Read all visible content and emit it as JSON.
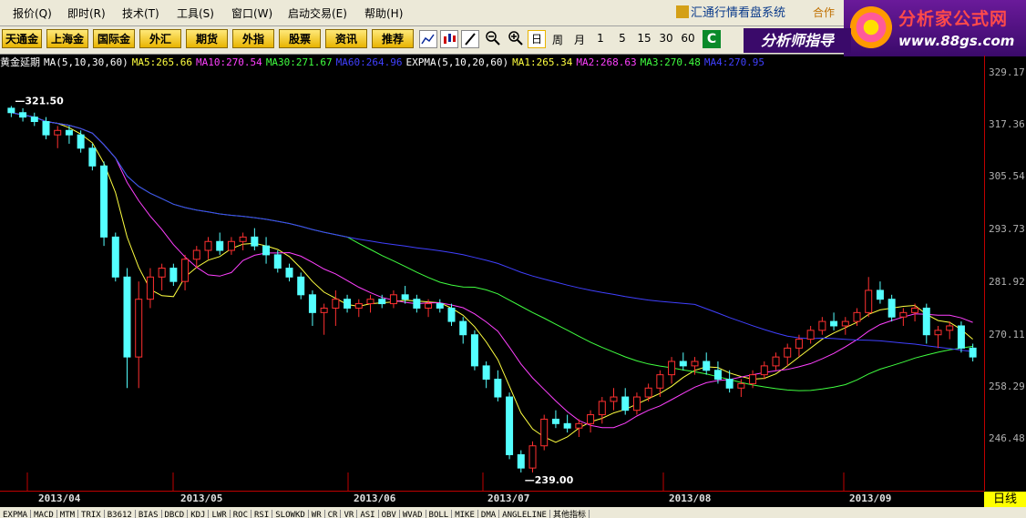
{
  "menu": {
    "items": [
      "报价(Q)",
      "即时(R)",
      "技术(T)",
      "工具(S)",
      "窗口(W)",
      "启动交易(E)",
      "帮助(H)"
    ],
    "brand": "汇通行情看盘系统",
    "brand_sub": "合作"
  },
  "logo": {
    "title": "分析家公式网",
    "url": "www.88gs.com"
  },
  "toolbar": {
    "buttons": [
      "天通金",
      "上海金",
      "国际金",
      "外汇",
      "期货",
      "外指",
      "股票",
      "资讯",
      "推荐"
    ],
    "periods": [
      "日",
      "周",
      "月",
      "1",
      "5",
      "15",
      "30",
      "60"
    ],
    "active_period": "日",
    "analyst": "分析师指导"
  },
  "indicators": {
    "symbol": "黄金延期",
    "ma_label": "MA(5,10,30,60)",
    "ma": [
      {
        "label": "MA5:265.66",
        "color": "#ffff40"
      },
      {
        "label": "MA10:270.54",
        "color": "#ff40ff"
      },
      {
        "label": "MA30:271.67",
        "color": "#40ff40"
      },
      {
        "label": "MA60:264.96",
        "color": "#4040ff"
      }
    ],
    "expma_label": "EXPMA(5,10,20,60)",
    "expma": [
      {
        "label": "MA1:265.34",
        "color": "#ffff40"
      },
      {
        "label": "MA2:268.63",
        "color": "#ff40ff"
      },
      {
        "label": "MA3:270.48",
        "color": "#40ff40"
      },
      {
        "label": "MA4:270.95",
        "color": "#4040ff"
      }
    ]
  },
  "yaxis": {
    "ticks": [
      "329.17",
      "317.36",
      "305.54",
      "293.73",
      "281.92",
      "270.11",
      "258.29",
      "246.48"
    ]
  },
  "xaxis": {
    "ticks": [
      "2013/04",
      "2013/05",
      "2013/06",
      "2013/07",
      "2013/08",
      "2013/09"
    ]
  },
  "period_label": "日线",
  "annotations": {
    "high": "321.50",
    "low": "239.00"
  },
  "bottom_tabs": [
    "EXPMA",
    "MACD",
    "MTM",
    "TRIX",
    "B3612",
    "BIAS",
    "DBCD",
    "KDJ",
    "LWR",
    "ROC",
    "RSI",
    "SLOWKD",
    "WR",
    "CR",
    "VR",
    "ASI",
    "OBV",
    "WVAD",
    "BOLL",
    "MIKE",
    "DMA",
    "ANGLELINE",
    "其他指标"
  ],
  "chart_data": {
    "type": "candlestick",
    "ylim": [
      239,
      329.17
    ],
    "candles": [
      [
        321,
        321.5,
        319,
        320
      ],
      [
        320,
        321,
        318,
        319
      ],
      [
        319,
        320,
        317,
        318
      ],
      [
        318,
        319,
        314,
        315
      ],
      [
        315,
        317,
        312,
        316
      ],
      [
        316,
        317,
        313,
        315
      ],
      [
        315,
        316,
        311,
        312
      ],
      [
        312,
        313,
        307,
        308
      ],
      [
        308,
        309,
        290,
        292
      ],
      [
        292,
        293,
        282,
        283
      ],
      [
        283,
        285,
        258,
        265
      ],
      [
        265,
        282,
        258,
        278
      ],
      [
        278,
        285,
        276,
        283
      ],
      [
        283,
        286,
        280,
        285
      ],
      [
        285,
        286,
        281,
        282
      ],
      [
        282,
        288,
        280,
        287
      ],
      [
        287,
        290,
        285,
        289
      ],
      [
        289,
        292,
        287,
        291
      ],
      [
        291,
        293,
        288,
        289
      ],
      [
        289,
        292,
        288,
        291
      ],
      [
        291,
        293,
        289,
        292
      ],
      [
        292,
        294,
        289,
        290
      ],
      [
        290,
        292,
        286,
        288
      ],
      [
        288,
        289,
        284,
        285
      ],
      [
        285,
        286,
        282,
        283
      ],
      [
        283,
        284,
        278,
        279
      ],
      [
        279,
        280,
        272,
        275
      ],
      [
        275,
        277,
        270,
        276
      ],
      [
        276,
        280,
        272,
        278
      ],
      [
        278,
        279,
        275,
        276
      ],
      [
        276,
        278,
        274,
        277
      ],
      [
        277,
        279,
        275,
        278
      ],
      [
        278,
        279,
        276,
        277
      ],
      [
        277,
        280,
        276,
        279
      ],
      [
        279,
        281,
        277,
        278
      ],
      [
        278,
        279,
        275,
        276
      ],
      [
        276,
        278,
        274,
        277
      ],
      [
        277,
        278,
        275,
        276
      ],
      [
        276,
        277,
        272,
        273
      ],
      [
        273,
        274,
        268,
        270
      ],
      [
        270,
        271,
        262,
        263
      ],
      [
        263,
        264,
        258,
        260
      ],
      [
        260,
        262,
        255,
        256
      ],
      [
        256,
        257,
        242,
        243
      ],
      [
        243,
        244,
        239,
        240
      ],
      [
        240,
        246,
        239,
        245
      ],
      [
        245,
        252,
        244,
        251
      ],
      [
        251,
        253,
        249,
        250
      ],
      [
        250,
        252,
        248,
        249
      ],
      [
        249,
        251,
        247,
        250
      ],
      [
        250,
        253,
        248,
        252
      ],
      [
        252,
        256,
        250,
        255
      ],
      [
        255,
        258,
        253,
        256
      ],
      [
        256,
        258,
        252,
        253
      ],
      [
        253,
        257,
        252,
        256
      ],
      [
        256,
        259,
        255,
        258
      ],
      [
        258,
        262,
        256,
        261
      ],
      [
        261,
        265,
        259,
        264
      ],
      [
        264,
        266,
        262,
        263
      ],
      [
        263,
        265,
        261,
        264
      ],
      [
        264,
        266,
        261,
        262
      ],
      [
        262,
        264,
        259,
        260
      ],
      [
        260,
        262,
        257,
        258
      ],
      [
        258,
        260,
        256,
        259
      ],
      [
        259,
        262,
        258,
        261
      ],
      [
        261,
        264,
        260,
        263
      ],
      [
        263,
        266,
        262,
        265
      ],
      [
        265,
        268,
        263,
        267
      ],
      [
        267,
        270,
        265,
        269
      ],
      [
        269,
        272,
        268,
        271
      ],
      [
        271,
        274,
        270,
        273
      ],
      [
        273,
        275,
        271,
        272
      ],
      [
        272,
        274,
        270,
        273
      ],
      [
        273,
        276,
        272,
        275
      ],
      [
        275,
        283,
        274,
        280
      ],
      [
        280,
        282,
        277,
        278
      ],
      [
        278,
        279,
        273,
        274
      ],
      [
        274,
        276,
        272,
        275
      ],
      [
        275,
        277,
        273,
        276
      ],
      [
        276,
        277,
        268,
        270
      ],
      [
        270,
        272,
        267,
        271
      ],
      [
        271,
        273,
        269,
        272
      ],
      [
        272,
        273,
        266,
        267
      ],
      [
        267,
        268,
        264,
        265
      ]
    ]
  }
}
